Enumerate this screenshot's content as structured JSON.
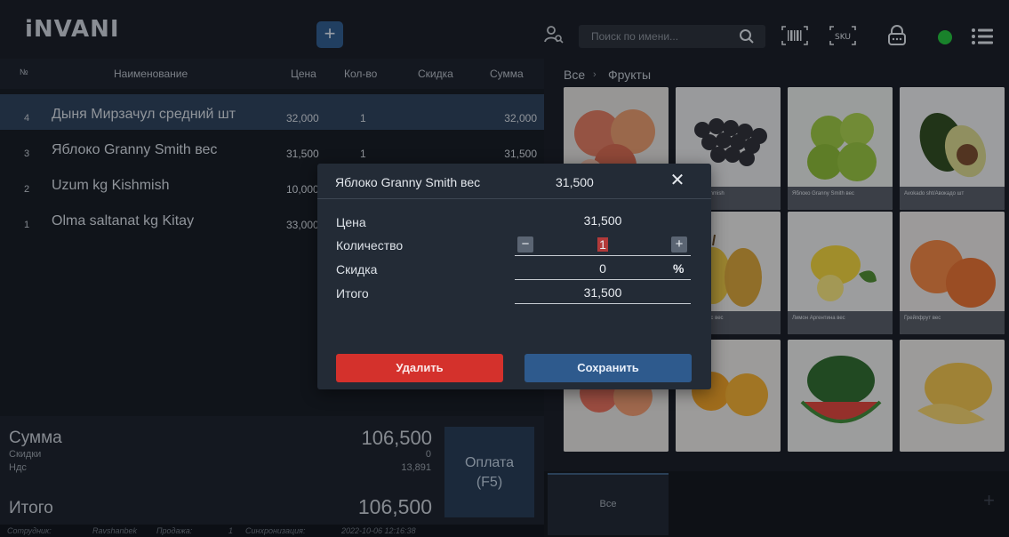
{
  "app": {
    "logo": "iNVANI"
  },
  "topbar": {
    "add_label": "+",
    "search_placeholder": "Поиск по имени...",
    "sku_label": "SKU"
  },
  "table": {
    "headers": {
      "num": "№",
      "name": "Наименование",
      "price": "Цена",
      "qty": "Кол-во",
      "discount": "Скидка",
      "sum": "Сумма"
    },
    "rows": [
      {
        "num": "4",
        "name": "Дыня Мирзачул средний шт",
        "price": "32,000",
        "qty": "1",
        "sum": "32,000",
        "selected": true
      },
      {
        "num": "3",
        "name": "Яблоко Granny Smith вес",
        "price": "31,500",
        "qty": "1",
        "sum": "31,500",
        "selected": false
      },
      {
        "num": "2",
        "name": "Uzum kg Kishmish",
        "price": "10,000",
        "qty": "",
        "sum": "",
        "selected": false
      },
      {
        "num": "1",
        "name": "Olma saltanat kg Kitay",
        "price": "33,000",
        "qty": "",
        "sum": "",
        "selected": false
      }
    ]
  },
  "totals": {
    "sum_label": "Сумма",
    "discount_label": "Скидки",
    "vat_label": "Ндс",
    "total_label": "Итого",
    "sum_value": "106,500",
    "discount_value": "0",
    "vat_value": "13,891",
    "total_value": "106,500",
    "pay_label": "Оплата",
    "pay_hotkey": "(F5)"
  },
  "statusbar": {
    "employee_label": "Сотрудник:",
    "employee_value": "Ravshanbek",
    "sale_label": "Продажа:",
    "sale_value": "1",
    "sync_label": "Синхронизация:",
    "sync_value": "2022-10-06 12:16:38"
  },
  "catalog": {
    "crumb_home": "Все",
    "crumb_arrow": "›",
    "crumb_category": "Фрукты",
    "tiles": [
      {
        "label": ""
      },
      {
        "label": "Uzum kg Kishmish"
      },
      {
        "label": "Яблоко Granny Smith вес"
      },
      {
        "label": "Avokado sht/Авокадо шт"
      },
      {
        "label": ""
      },
      {
        "label": "Груша Бошес вес"
      },
      {
        "label": "Лимон Аргентина вес"
      },
      {
        "label": "Грейпфрут вес"
      },
      {
        "label": ""
      },
      {
        "label": ""
      },
      {
        "label": ""
      },
      {
        "label": ""
      }
    ],
    "bottom_tab": "Все",
    "bottom_plus": "+"
  },
  "modal": {
    "title": "Яблоко Granny Smith вес",
    "header_price": "31,500",
    "close": "✕",
    "price_label": "Цена",
    "price_value": "31,500",
    "qty_label": "Количество",
    "qty_value": "1",
    "qty_minus": "−",
    "qty_plus": "+",
    "discount_label": "Скидка",
    "discount_value": "0",
    "discount_unit": "%",
    "total_label": "Итого",
    "total_value": "31,500",
    "delete_label": "Удалить",
    "save_label": "Сохранить"
  },
  "colors": {
    "accent": "#2e5a8d",
    "danger": "#d4312c",
    "online": "#23c23a",
    "selected_row": "#2c3f58"
  }
}
